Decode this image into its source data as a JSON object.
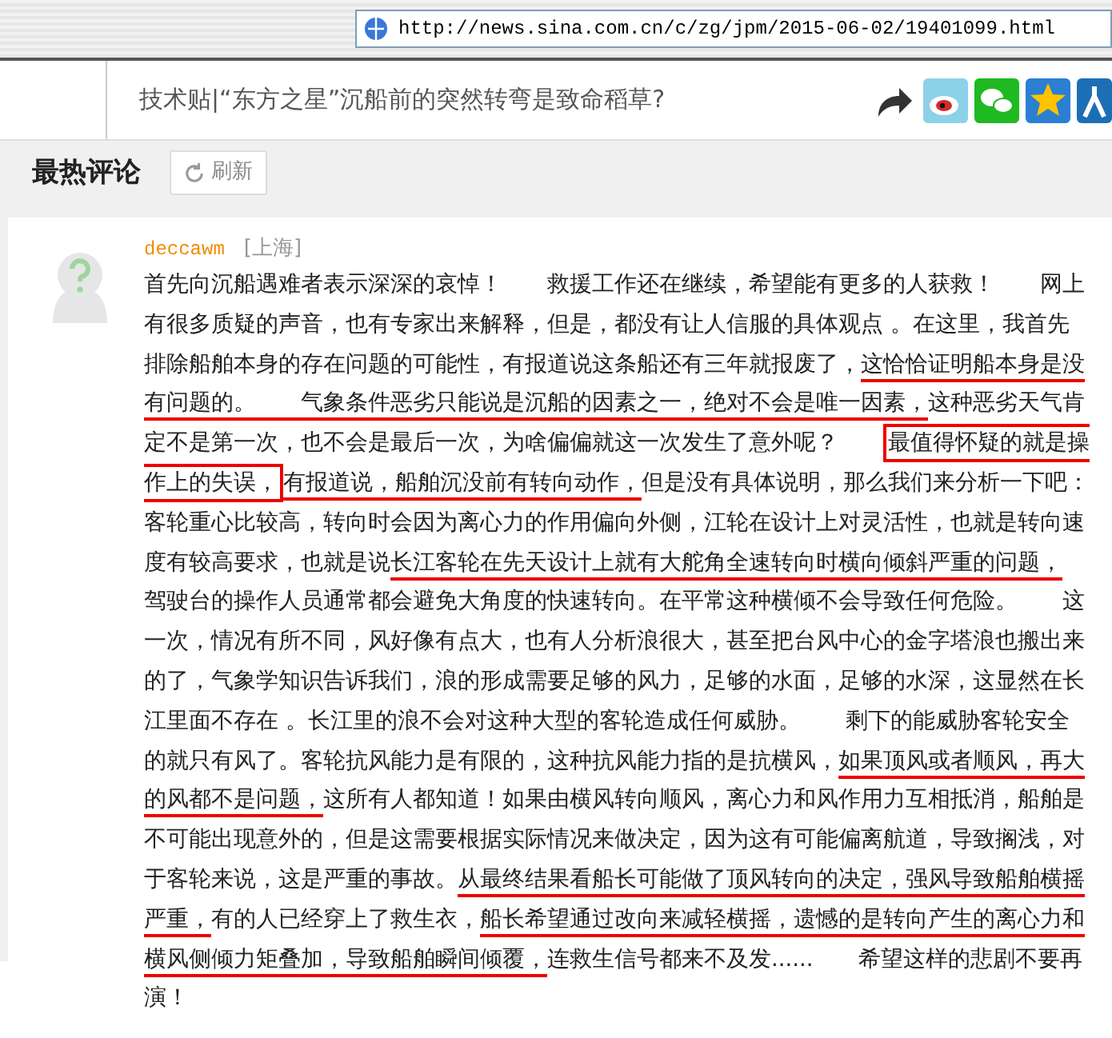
{
  "browser": {
    "url": "http://news.sina.com.cn/c/zg/jpm/2015-06-02/19401099.html"
  },
  "article": {
    "title": "技术贴|“东方之星”沉船前的突然转弯是致命稻草?"
  },
  "section": {
    "title": "最热评论",
    "refresh_button": "刷新"
  },
  "comment": {
    "user": "deccawm",
    "location": "[上海]",
    "segments": [
      {
        "kind": "plain",
        "text": "首先向沉船遇难者表示深深的哀悼！　　救援工作还在继续，希望能有更多的人获救！　　网上有很多质疑的声音，也有专家出来解释，但是，都没有让人信服的具体观点 。在这里，我首先排除船舶本身的存在问题的可能性，有报道说这条船还有三年就报废了，"
      },
      {
        "kind": "underlined",
        "text": "这恰恰证明船本身是没有问题的。　　"
      },
      {
        "kind": "underlined",
        "text": "气象条件恶劣只能说是沉船的因素之一，绝对不会是唯一因素，"
      },
      {
        "kind": "plain",
        "text": "这种恶劣天气肯定不是第一次，也不会是最后一次，为啥偏偏就这一次发生了意外呢？　　"
      },
      {
        "kind": "boxed",
        "text": "最值得怀疑的就是操作上的失误，"
      },
      {
        "kind": "underlined",
        "text": "有报道说，船舶沉没前有转向动作，"
      },
      {
        "kind": "plain",
        "text": "但是没有具体说明，那么我们来分析一下吧：客轮重心比较高，转向时会因为离心力的作用偏向外侧，江轮在设计上对灵活性，也就是转向速度有较高要求，也就是说"
      },
      {
        "kind": "underlined",
        "text": "长江客轮在先天设计上就有大舵角全速转向时横向倾斜严重的问题，"
      },
      {
        "kind": "plain",
        "text": "　驾驶台的操作人员通常都会避免大角度的快速转向。在平常这种横倾不会导致任何危险。　　这一次，情况有所不同，风好像有点大，也有人分析浪很大，甚至把台风中心的金字塔浪也搬出来的了，气象学知识告诉我们，浪的形成需要足够的风力，足够的水面，足够的水深，这显然在长江里面不存在 。长江里的浪不会对这种大型的客轮造成任何威胁。　　剩下的能威胁客轮安全的就只有风了。客轮抗风能力是有限的，这种抗风能力指的是抗横风，"
      },
      {
        "kind": "underlined",
        "text": "如果顶风或者顺风，再大的风都不是问题，"
      },
      {
        "kind": "plain",
        "text": "这所有人都知道！如果由横风转向顺风，离心力和风作用力互相抵消，船舶是不可能出现意外的，但是这需要根据实际情况来做决定，因为这有可能偏离航道，导致搁浅，对于客轮来说，这是严重的事故。"
      },
      {
        "kind": "underlined",
        "text": "从最终结果看船长可能做了顶风转向的决定，强风导致船舶横摇严重，"
      },
      {
        "kind": "plain",
        "text": "有的人已经穿上了救生衣，"
      },
      {
        "kind": "underlined",
        "text": "船长希望通过改向来减轻横摇，遗憾的是转向产生的离心力和横风侧倾力矩叠加，导致船舶瞬间倾覆，"
      },
      {
        "kind": "plain",
        "text": "连救生信号都来不及发......　　希望这样的悲剧不要再演！"
      }
    ]
  }
}
